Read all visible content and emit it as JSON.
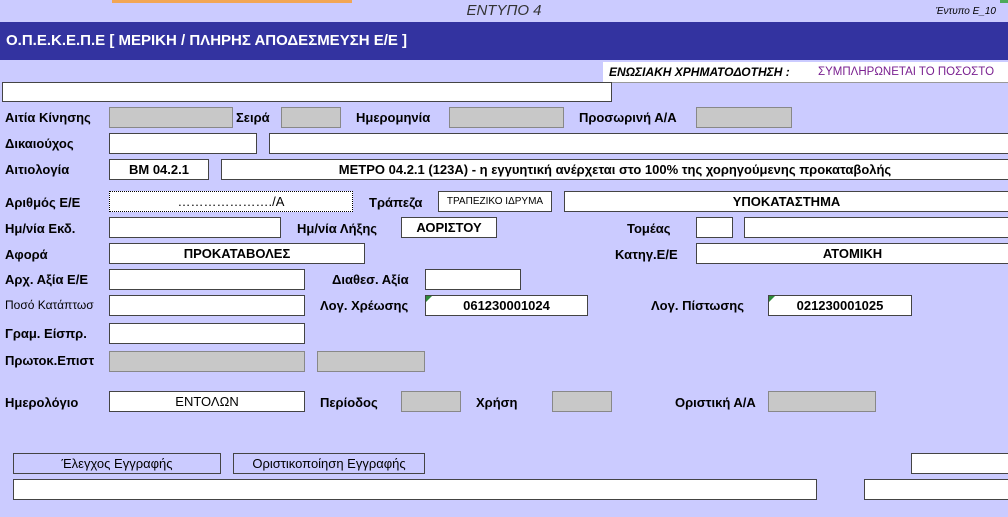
{
  "form": {
    "title": "ΕΝΤΥΠΟ 4",
    "code": "Έντυπο Ε_10",
    "header": "Ο.Π.Ε.Κ.Ε.Π.Ε [ ΜΕΡΙΚΗ / ΠΛΗΡΗΣ ΑΠΟΔΕΣΜΕΥΣΗ Ε/Ε ]"
  },
  "funding": {
    "label": "ΕΝΩΣΙΑΚΗ ΧΡΗΜΑΤΟΔΟΤΗΣΗ :",
    "value": "ΣΥΜΠΛΗΡΩΝΕΤΑΙ ΤΟ ΠΟΣΟΣΤΟ"
  },
  "labels": {
    "cause": "Αιτία Κίνησης",
    "series": "Σειρά",
    "date": "Ημερομηνία",
    "temp_aa": "Προσωρινή Α/Α",
    "beneficiary": "Δικαιούχος",
    "justification": "Αιτιολογία",
    "guarantee_no": "Αριθμός Ε/Ε",
    "bank": "Τράπεζα",
    "issue_date": "Ημ/νία Εκδ.",
    "expiry_date": "Ημ/νία Λήξης",
    "sector": "Τομέας",
    "concerns": "Αφορά",
    "category": "Κατηγ.Ε/Ε",
    "initial_value": "Αρχ. Αξία Ε/Ε",
    "available_value": "Διαθεσ. Αξία",
    "forfeit_amount": "Ποσό Κατάπτωσ",
    "debit_account": "Λογ. Χρέωσης",
    "credit_account": "Λογ. Πίστωσης",
    "receipt_line": "Γραμ. Είσπρ.",
    "protocol": "Πρωτοκ.Επιστ",
    "journal": "Ημερολόγιο",
    "period": "Περίοδος",
    "year": "Χρήση",
    "final_aa": "Οριστική Α/Α"
  },
  "values": {
    "justification_code": "ΒΜ 04.2.1",
    "justification_text": "ΜΕΤΡΟ 04.2.1 (123Α) - η εγγυητική ανέρχεται στο 100% της χορηγούμενης προκαταβολής",
    "guarantee_no": "…………………./Α",
    "bank": "ΤΡΑΠΕΖΙΚΟ ΙΔΡΥΜΑ",
    "branch": "ΥΠΟΚΑΤΑΣΤΗΜΑ",
    "expiry_date": "ΑΟΡΙΣΤΟΥ",
    "concerns": "ΠΡΟΚΑΤΑΒΟΛΕΣ",
    "category": "ΑΤΟΜΙΚΗ",
    "debit_account": "061230001024",
    "credit_account": "021230001025",
    "journal": "ΕΝΤΟΛΩΝ"
  },
  "buttons": {
    "check": "Έλεγχος Εγγραφής",
    "finalize": "Οριστικοποίηση Εγγραφής"
  }
}
